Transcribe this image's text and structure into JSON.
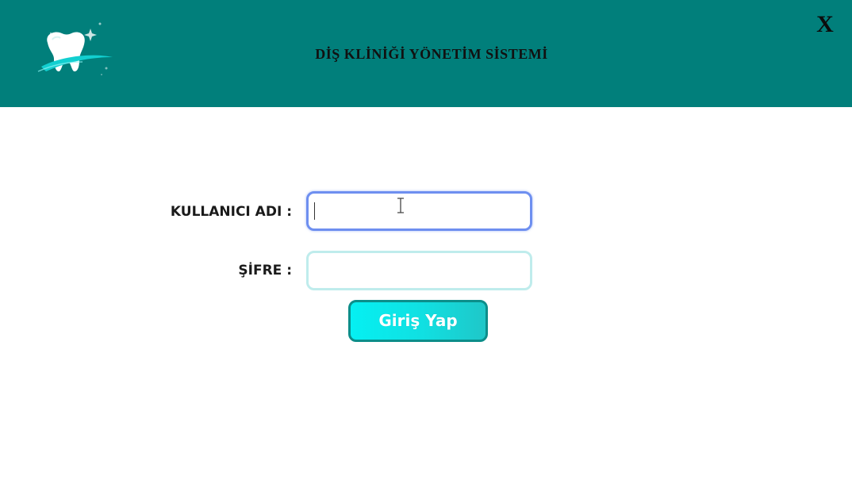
{
  "header": {
    "title": "DİŞ KLİNİĞİ YÖNETİM SİSTEMİ",
    "close_label": "X",
    "logo_icon": "tooth-logo-icon",
    "background_color": "#017f7b"
  },
  "form": {
    "username_label": "KULLANICI ADI :",
    "username_value": "",
    "password_label": "ŞİFRE :",
    "password_value": "",
    "submit_label": "Giriş Yap",
    "focused_field": "username"
  },
  "colors": {
    "accent": "#05f0f2",
    "focus_border": "#6e8ff0",
    "field_border": "#bfecec"
  }
}
